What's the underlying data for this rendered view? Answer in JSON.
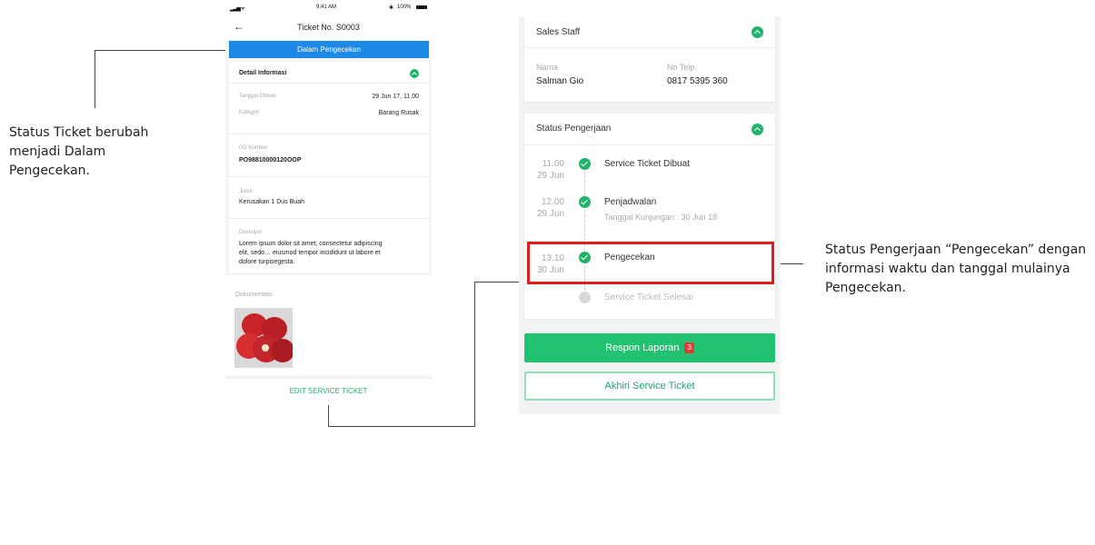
{
  "annotations": {
    "left_note": [
      "Status Ticket berubah",
      "menjadi Dalam",
      "Pengecekan."
    ],
    "right_note": [
      "Status Pengerjaan “Pengecekan” dengan",
      "informasi waktu dan tanggal mulainya",
      "Pengecekan."
    ]
  },
  "phone": {
    "status_bar": {
      "time": "9:41 AM",
      "battery": "100%"
    },
    "title": "Ticket No. S0003",
    "status_banner": "Dalam Pengecekan",
    "detail": {
      "header": "Detail Informasi",
      "rows": [
        {
          "label": "Tanggal Dibuat",
          "value": "29 Jun 17, 11.00"
        },
        {
          "label": "Kategori",
          "value": "Barang Rusak"
        }
      ],
      "po_label": "PO Number",
      "po_value": "PO98810000120OOP",
      "judul_label": "Judul",
      "judul_value": "Kerusakan 1 Dus Buah",
      "deskripsi_label": "Deskripsi",
      "deskripsi_value": [
        "Lorem ipsum dolor sit amet, consectetur adipiscing",
        "elit, sedo… eiusmod tempor incididunt ut labore et",
        "dolore turpisegesta."
      ]
    },
    "dokumentasi_label": "Dokumentasi",
    "edit_button": "EDIT SERVICE TICKET"
  },
  "right": {
    "sales": {
      "header": "Sales Staff",
      "name_label": "Nama",
      "name_value": "Salman Gio",
      "phone_label": "No Telp.",
      "phone_value": "0817 5395 360"
    },
    "status": {
      "header": "Status Pengerjaan",
      "steps": [
        {
          "time": "11.00",
          "date": "29 Jun",
          "label": "Service Ticket Dibuat",
          "sub": "",
          "done": true
        },
        {
          "time": "12.00",
          "date": "29 Jun",
          "label": "Penjadwalan",
          "sub": "Tanggal Kunjungan : 30 Jun 18",
          "done": true
        },
        {
          "time": "13.10",
          "date": "30 Jun",
          "label": "Pengecekan",
          "sub": "",
          "done": true
        },
        {
          "time": "",
          "date": "",
          "label": "Service Ticket Selesai",
          "sub": "",
          "done": false
        }
      ]
    },
    "respon_button": "Respon Laporan",
    "respon_count": "3",
    "akhiri_button": "Akhiri Service Ticket"
  },
  "colors": {
    "primary_blue": "#1e88e5",
    "green": "#21c371",
    "highlight_red": "#e21b1b"
  }
}
